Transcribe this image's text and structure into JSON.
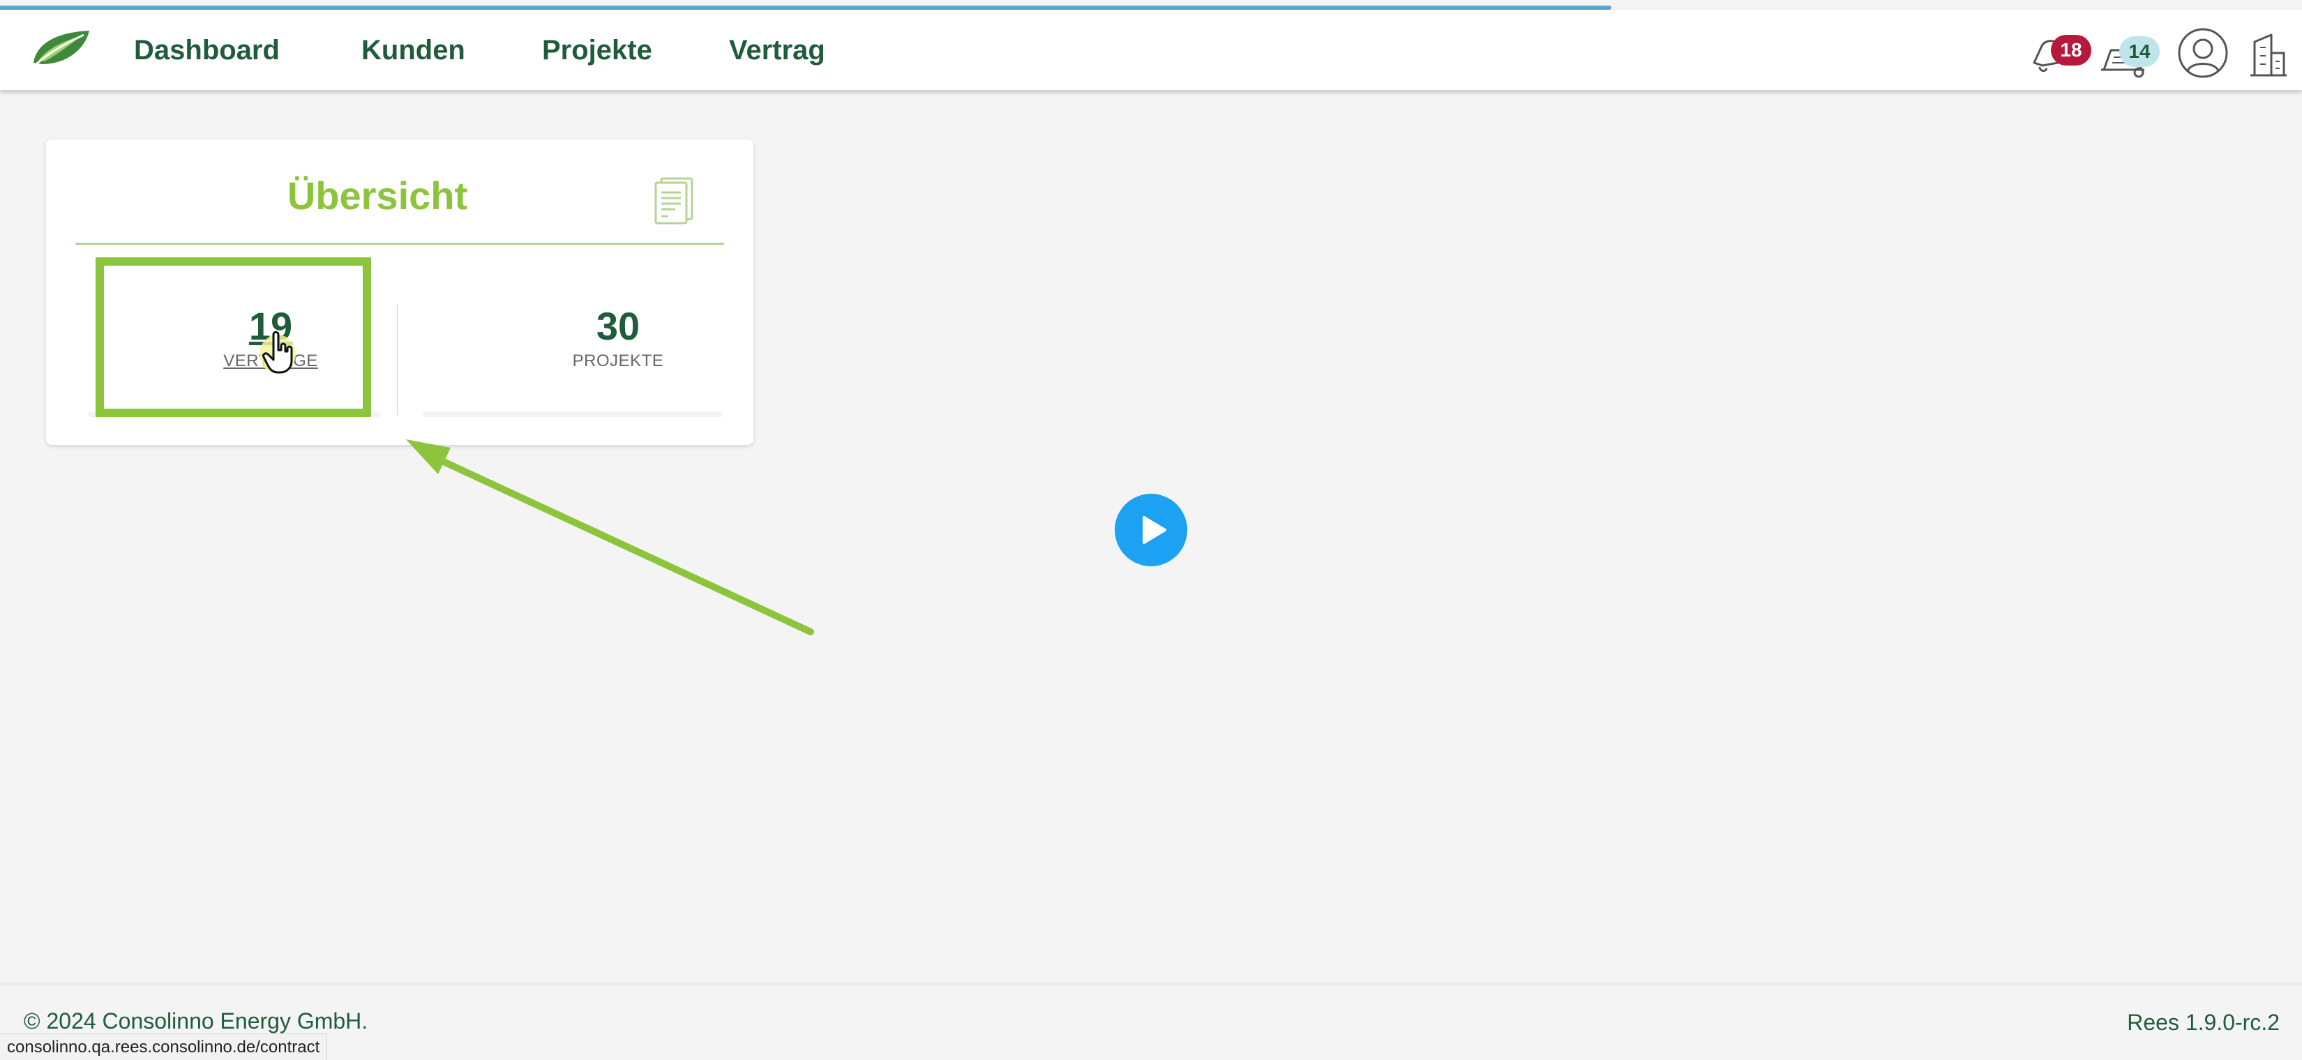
{
  "colors": {
    "brand_green": "#8cc43b",
    "dark_green": "#1f5c3a",
    "alert_red": "#b5193b",
    "notice_blue": "#bfe4ea",
    "play_blue": "#1da1f2",
    "progress_blue": "#53a9cf"
  },
  "page_load_progress_percent": 70,
  "header": {
    "logo_icon": "leaf-logo-icon",
    "nav": [
      {
        "label": "Dashboard"
      },
      {
        "label": "Kunden"
      },
      {
        "label": "Projekte"
      },
      {
        "label": "Vertrag"
      }
    ],
    "notifications": {
      "icon": "bell-icon",
      "count": "18"
    },
    "tickets": {
      "icon": "ticket-icon",
      "count": "14"
    },
    "profile": {
      "icon": "user-icon"
    },
    "company": {
      "icon": "building-icon"
    }
  },
  "overview_card": {
    "title": "Übersicht",
    "icon": "document-icon",
    "stats": [
      {
        "value": "19",
        "label": "VERTRÄGE"
      },
      {
        "value": "30",
        "label": "PROJEKTE"
      }
    ]
  },
  "annotations": {
    "highlight_box_color": "#8cc43b",
    "arrow_color": "#8cc43b",
    "cursor_icon": "hand-pointer-icon"
  },
  "video": {
    "icon": "play-icon"
  },
  "footer": {
    "copyright": "© 2024 Consolinno Energy GmbH.",
    "version": "Rees 1.9.0-rc.2"
  },
  "status_bar": {
    "url": "consolinno.qa.rees.consolinno.de/contract"
  }
}
